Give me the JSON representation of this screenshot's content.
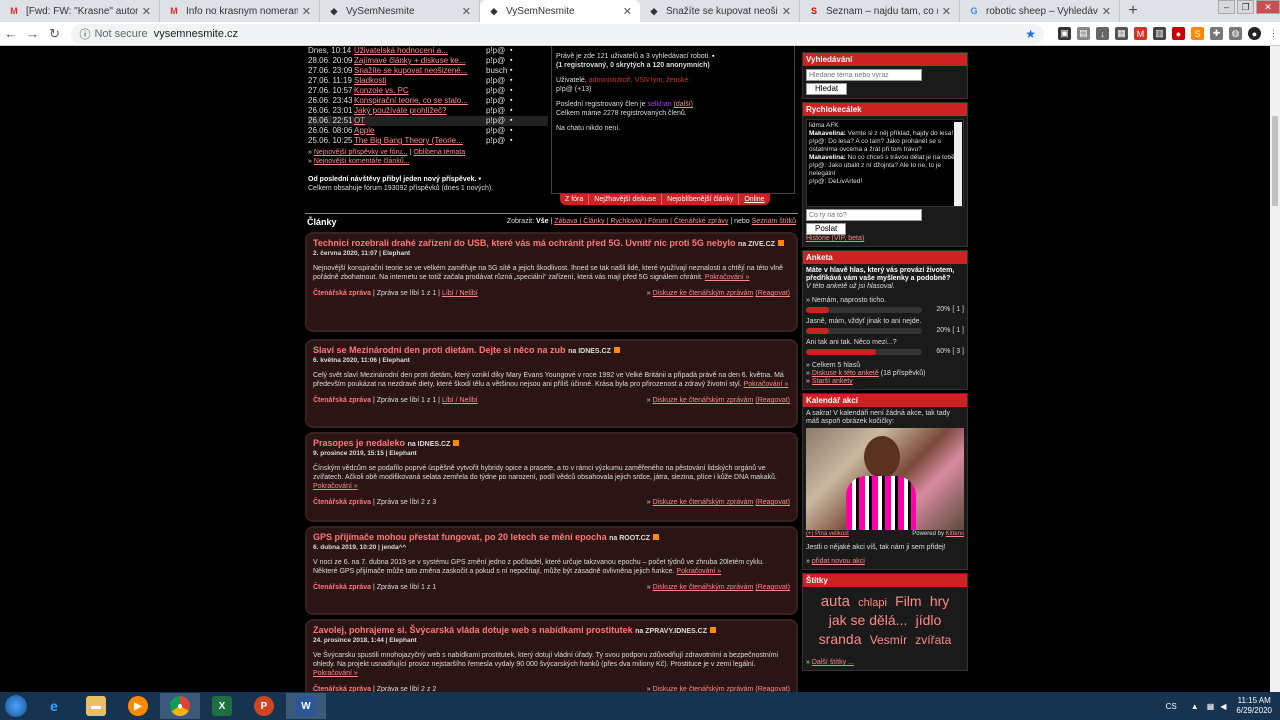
{
  "browser": {
    "tabs": [
      {
        "title": "[Fwd: FW: \"Krasne\" automobi",
        "fav": "M",
        "favcolor": "#d93025",
        "active": false
      },
      {
        "title": "Info no krasnym nomeram na a",
        "fav": "M",
        "favcolor": "#d93025",
        "active": false
      },
      {
        "title": "VySemNesmite",
        "fav": "◆",
        "favcolor": "#333",
        "active": false
      },
      {
        "title": "VySemNesmite",
        "fav": "◆",
        "favcolor": "#333",
        "active": true
      },
      {
        "title": "Snažíte se kupovat neošizené po",
        "fav": "◆",
        "favcolor": "#333",
        "active": false
      },
      {
        "title": "Seznam – najdu tam, co neznám",
        "fav": "S",
        "favcolor": "#c00",
        "active": false
      },
      {
        "title": "robotic sheep – Vyhledávání Goo",
        "fav": "G",
        "favcolor": "#4285f4",
        "active": false
      }
    ],
    "new_tab": "+",
    "not_secure": "Not secure",
    "url": "vysemnesmite.cz"
  },
  "latest": {
    "rows": [
      {
        "date": "Dnes, 10:14",
        "title": "Uživatelská hodnocení a...",
        "user": "p!p@"
      },
      {
        "date": "28.06. 20:09",
        "title": "Zajímavé články + diskuse ke...",
        "user": "p!p@"
      },
      {
        "date": "27.06. 23:09",
        "title": "Snažíte se kupovat neošizené...",
        "user": "busch"
      },
      {
        "date": "27.06. 11:19",
        "title": "Sladkosti",
        "user": "p!p@"
      },
      {
        "date": "27.06. 10:57",
        "title": "Konzole vs. PC",
        "user": "p!p@"
      },
      {
        "date": "26.06. 23:43",
        "title": "Konspirační teorie, co se stalo...",
        "user": "p!p@"
      },
      {
        "date": "26.06. 23:01",
        "title": "Jaký používáte prohlížeč?",
        "user": "p!p@"
      },
      {
        "date": "26.06. 22:51",
        "title": "OT",
        "user": "p!p@"
      },
      {
        "date": "26.06. 08:06",
        "title": "Apple",
        "user": "p!p@"
      },
      {
        "date": "25.06. 10:25",
        "title": "The Big Bang Theory (Teorie...",
        "user": "p!p@"
      }
    ],
    "more1": "Nejnovější příspěvky ve fóru...",
    "more1b": "Oblíbená témata",
    "more2": "Nejnovější komentáře článků...",
    "since1": "Od poslední návštěvy přibyl jeden nový příspěvek.",
    "since2": "Celkem obsahuje fórum 193092 příspěvků (dnes 1 nových)."
  },
  "online": {
    "l1": "Právě je zde 121 uživatelů a 3 vyhledávací roboti.",
    "l2": "(1 registrovaný, 0 skrytých a 120 anonymních)",
    "users_label": "Uživatelé,",
    "users_roles": "administrátoři, VSN tým, ženské:",
    "users_list": "p!p@ (+13)",
    "last1": "Poslední registrovaný člen je",
    "last_name": "selkhan",
    "last_more": "(další)",
    "last2": "Celkem máme 2278 registrovaných členů.",
    "chat": "Na chatu nikdo není.",
    "tabs": [
      "Z fóra",
      "Nejžhavější diskuse",
      "Nejoblíbenější články",
      "Online"
    ]
  },
  "clanky": {
    "heading": "Články",
    "filter_label": "Zobrazit:",
    "filter_all": "Vše",
    "filters": "Zábava | Články | Rychlovky | Fórum | Čtenářské zprávy",
    "filter_or": "| nebo",
    "filter_tags": "Seznam štítků"
  },
  "articles": [
    {
      "title": "Technici rozebrali drahé zařízení do USB, které vás má ochránit před 5G. Uvnitř nic proti 5G nebylo",
      "src": "na ZIVE.CZ",
      "meta": "2. června 2020, 11:07 | Elephant",
      "body": "Nejnovější konspirační teorie se ve velkém zaměřuje na 5G sítě a jejich škodlivost. Ihned se tak našli lidé, které využívají neznalosti a chtějí na této vlně pořádně zbohatnout. Na internetu se totiž začala prodávat různá „speciální“ zařízení, která vás mají před 5G signálem chránit.",
      "more": "Pokračování »",
      "cat": "Čtenářská zpráva",
      "likes": "| Zpráva se líbí 1 z 1 |",
      "vote": "Líbí / Nelíbí",
      "disc": "Diskuze ke čtenářským zprávám",
      "react": "(Reagovat)"
    },
    {
      "title": "Slaví se Mezinárodní den proti dietám. Dejte si něco na zub",
      "src": "na IDNES.CZ",
      "meta": "6. května 2020, 11:06 | Elephant",
      "body": "Celý svět slaví Mezinárodní den proti dietám, který vznikl díky Mary Evans Youngové v roce 1992 ve Velké Británii a připadá právě na den 6. května. Má především poukázat na nezdravé diety, které škodí tělu a většinou nejsou ani příliš účinné. Krása byla pro přirozenost a zdravý životní styl.",
      "more": "Pokračování »",
      "cat": "Čtenářská zpráva",
      "likes": "| Zpráva se líbí 1 z 1 |",
      "vote": "Líbí / Nelíbí",
      "disc": "Diskuze ke čtenářským zprávám",
      "react": "(Reagovat)"
    },
    {
      "title": "Prasopes je nedaleko",
      "src": "na IDNES.CZ",
      "meta": "9. prosince 2019, 15:15 | Elephant",
      "body": "Čínským vědcům se podařilo poprvé úspěšně vytvořit hybridy opice a prasete, a to v rámci výzkumu zaměřeného na pěstování lidských orgánů ve zvířatech. Ačkoli obě modifikovaná selata zemřela do týdne po narození, podíl vědců obsahovala jejich srdce, játra, slezina, plíce i kůže DNA makaků.",
      "more": "Pokračování »",
      "cat": "Čtenářská zpráva",
      "likes": "| Zpráva se líbí 2 z 3",
      "vote": "",
      "disc": "Diskuze ke čtenářským zprávám",
      "react": "(Reagovat)"
    },
    {
      "title": "GPS přijímače mohou přestat fungovat, po 20 letech se mění epocha",
      "src": "na ROOT.CZ",
      "meta": "6. dubna 2019, 10:20 | jenda^^",
      "body": "V noci ze 6. na 7. dubna 2019 se v systému GPS změní jedno z počítadel, které určuje takzvanou epochu – počet týdnů ve zhruba 20letém cyklu. Některé GPS přijímače může tato změna zaskočit a pokud s ní nepočítají, může být zásadně ovlivněna jejich funkce.",
      "more": "Pokračování »",
      "cat": "Čtenářská zpráva",
      "likes": "| Zpráva se líbí 1 z 1",
      "vote": "",
      "disc": "Diskuze ke čtenářským zprávám",
      "react": "(Reagovat)"
    },
    {
      "title": "Zavolej, pohrajeme si. Švýcarská vláda dotuje web s nabídkami prostitutek",
      "src": "na ZPRAVY.IDNES.CZ",
      "meta": "24. prosince 2018, 1:44 | Elephant",
      "body": "Ve Švýcarsku spustili mnohojazyčný web s nabídkami prostitutek, který dotují vládní úřady. Ty svou podporu zdůvodňují zdravotními a bezpečnostními ohledy. Na projekt usnadňující provoz nejstaršího řemesla vydaly 90 000 švýcarských franků (přes dva miliony Kč). Prostituce je v zemi legální.",
      "more": "Pokračování »",
      "cat": "Čtenářská zpráva",
      "likes": "| Zpráva se líbí 2 z 2",
      "vote": "",
      "disc": "Diskuze ke čtenářským zprávám",
      "react": "(Reagovat)"
    }
  ],
  "sidebar": {
    "search_h": "Vyhledávání",
    "search_ph": "Hledané téma nebo výraz",
    "search_btn": "Hledat",
    "chat_h": "Rychlokecálek",
    "chat_lines": [
      {
        "who": "",
        "text": "lidma AFK"
      },
      {
        "who": "Makavelina:",
        "text": "Vemte si z něj příklad, hajdy do lesa!"
      },
      {
        "who": "",
        "text": "p!p@: Do lesa? A co tam? Jako prohánět se s ostatníma ovcema a žrát při tom trávu?"
      },
      {
        "who": "Makavelina:",
        "text": "No co chceš s trávou dělat je na tobě..."
      },
      {
        "who": "",
        "text": "p!p@: Jako ubalit z ní džojnta? Ale to ne, to je nelegální"
      },
      {
        "who": "",
        "text": "p!p@: DeLivArted!"
      }
    ],
    "chat_ph": "Co ty na to?",
    "chat_btn": "Poslat",
    "chat_hist": "Historie (VIP, beta)",
    "poll_h": "Anketa",
    "poll_q": "Máte v hlavě hlas, který vás provází životem, předříkává vám vaše myšlenky a podobně?",
    "poll_note": "V této anketě už jsi hlasoval.",
    "poll_opts": [
      {
        "label": "» Nemám, naprosto ticho.",
        "pct": 0.2,
        "val": "20% [ 1 ]"
      },
      {
        "label": "Jasně, mám, vždyť jinak to ani nejde.",
        "pct": 0.2,
        "val": "20% [ 1 ]"
      },
      {
        "label": "Ani tak ani tak. Něco mezi...?",
        "pct": 0.6,
        "val": "60% [ 3 ]"
      }
    ],
    "poll_total": "» Celkem 5 hlasů",
    "poll_disc": "Diskuse k této anketě",
    "poll_disc_n": "(18 příspěvků)",
    "poll_old": "Starší ankety",
    "cal_h": "Kalendář akcí",
    "cal_text": "A sakra! V kalendáři není žádná akce, tak tady máš aspoň obrázek kočičky:",
    "cal_full": "(+) Plná velikost",
    "cal_powered": "Powered by",
    "cal_kittens": "Kittens",
    "cal_text2": "Jestli o nějaké akci víš, tak nám ji sem přidej!",
    "cal_add": "přidat novou akci",
    "tags_h": "Štítky",
    "tags": [
      {
        "t": "auta",
        "s": 15
      },
      {
        "t": "chlapi",
        "s": 11
      },
      {
        "t": "Film",
        "s": 14
      },
      {
        "t": "hry",
        "s": 14
      },
      {
        "t": "jak se dělá...",
        "s": 14
      },
      {
        "t": "jídlo",
        "s": 14
      },
      {
        "t": "sranda",
        "s": 14
      },
      {
        "t": "Vesmír",
        "s": 12
      },
      {
        "t": "zvířata",
        "s": 12
      }
    ],
    "tags_more": "Další štítky ..."
  },
  "taskbar": {
    "lang": "CS",
    "time": "11:15 AM",
    "date": "6/29/2020"
  }
}
